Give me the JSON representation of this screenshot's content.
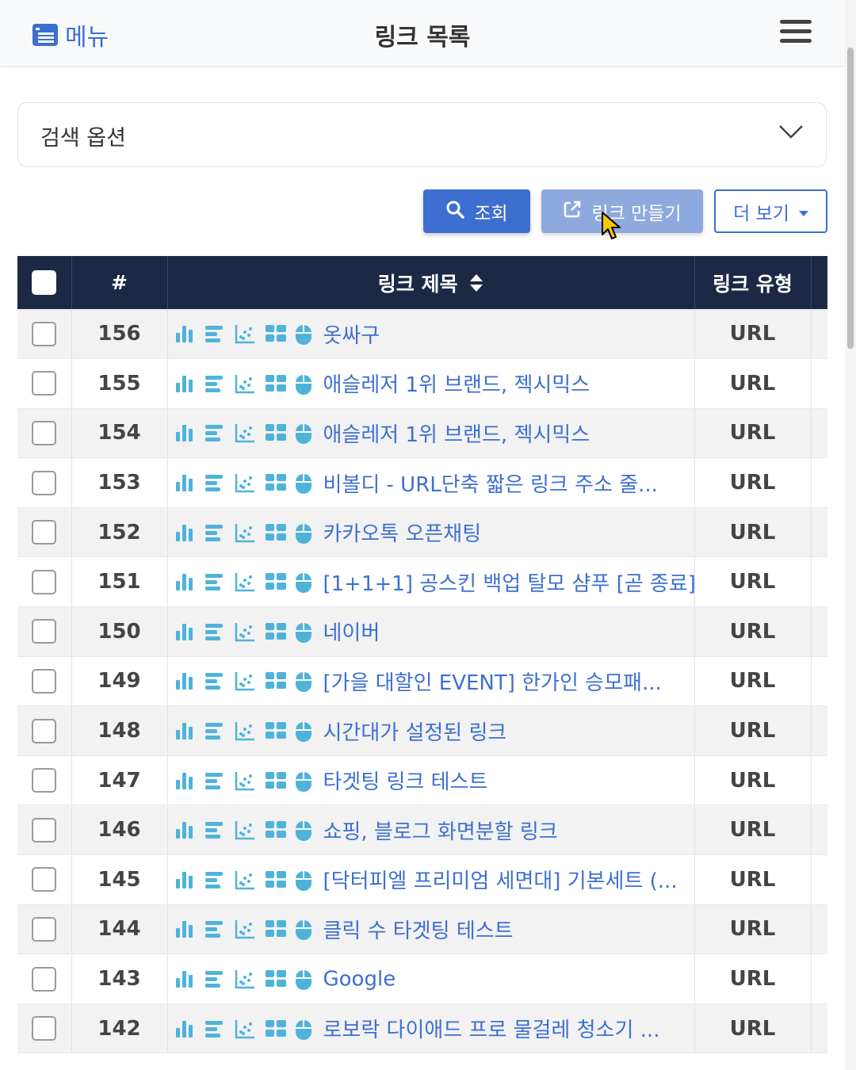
{
  "header": {
    "menu_label": "메뉴",
    "title": "링크 목록"
  },
  "search_options": {
    "label": "검색 옵션"
  },
  "toolbar": {
    "search_label": "조회",
    "create_label": "링크 만들기",
    "more_label": "더 보기"
  },
  "table": {
    "columns": [
      "#",
      "링크 제목",
      "링크 유형"
    ],
    "row_icons": [
      "bar-chart-icon",
      "align-left-icon",
      "scatter-chart-icon",
      "grid-icon",
      "mouse-icon"
    ],
    "rows": [
      {
        "num": "156",
        "title": "옷싸구",
        "type": "URL"
      },
      {
        "num": "155",
        "title": "애슬레저 1위 브랜드, 젝시믹스",
        "type": "URL"
      },
      {
        "num": "154",
        "title": "애슬레저 1위 브랜드, 젝시믹스",
        "type": "URL"
      },
      {
        "num": "153",
        "title": "비볼디 - URL단축 짧은 링크 주소 줄...",
        "type": "URL"
      },
      {
        "num": "152",
        "title": "카카오톡 오픈채팅",
        "type": "URL"
      },
      {
        "num": "151",
        "title": "[1+1+1] 공스킨 백업 탈모 샴푸 [곧 종료]",
        "type": "URL"
      },
      {
        "num": "150",
        "title": "네이버",
        "type": "URL"
      },
      {
        "num": "149",
        "title": "[가을 대할인 EVENT] 한가인 승모패...",
        "type": "URL"
      },
      {
        "num": "148",
        "title": "시간대가 설정된 링크",
        "type": "URL"
      },
      {
        "num": "147",
        "title": "타겟팅 링크 테스트",
        "type": "URL"
      },
      {
        "num": "146",
        "title": "쇼핑, 블로그 화면분할 링크",
        "type": "URL"
      },
      {
        "num": "145",
        "title": "[닥터피엘 프리미엄 세면대] 기본세트 (...",
        "type": "URL"
      },
      {
        "num": "144",
        "title": "클릭 수 타겟팅 테스트",
        "type": "URL"
      },
      {
        "num": "143",
        "title": "Google",
        "type": "URL"
      },
      {
        "num": "142",
        "title": "로보락 다이애드 프로 물걸레 청소기 ...",
        "type": "URL"
      }
    ]
  },
  "colors": {
    "accent": "#3d6fd1",
    "header_bg": "#1c2945",
    "icon_teal": "#4fb3d9"
  }
}
